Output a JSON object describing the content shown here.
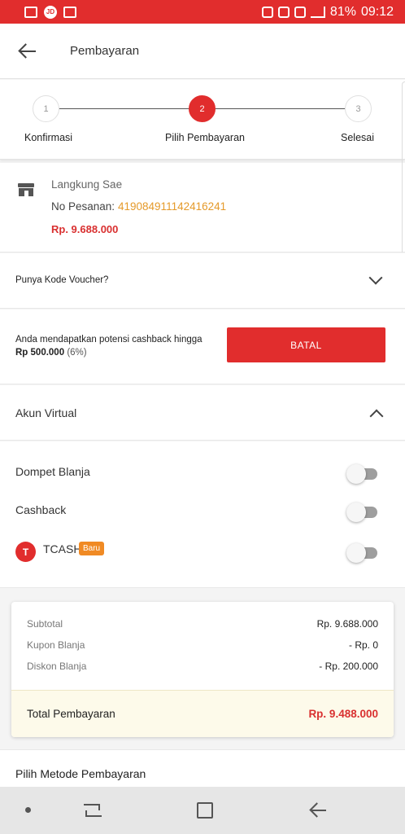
{
  "status_bar": {
    "left_icons": [
      "gallery-icon",
      "jd-icon",
      "message-icon"
    ],
    "right_icons": [
      "alarm-icon",
      "wifi-icon",
      "call-icon",
      "signal-icon"
    ],
    "battery": "81%",
    "time": "09:12",
    "color": "#e12d2d"
  },
  "header": {
    "title": "Pembayaran"
  },
  "stepper": {
    "steps": [
      {
        "num": "1",
        "label": "Konfirmasi",
        "active": false
      },
      {
        "num": "2",
        "label": "Pilih Pembayaran",
        "active": true
      },
      {
        "num": "3",
        "label": "Selesai",
        "active": false
      }
    ]
  },
  "store": {
    "name": "Langkung Sae",
    "order_label": "No Pesanan:",
    "order_number": "419084911142416241",
    "price": "Rp. 9.688.000"
  },
  "voucher": {
    "label": "Punya Kode Voucher?"
  },
  "cashback": {
    "text": "Anda mendapatkan potensi cashback hingga",
    "amount": "Rp 500.000",
    "percent": "(6%)",
    "button": "BATAL"
  },
  "akun_virtual": {
    "title": "Akun Virtual",
    "items": [
      {
        "label": "Dompet Blanja",
        "enabled": false
      },
      {
        "label": "Cashback",
        "enabled": false
      },
      {
        "label": "TCASH",
        "badge": "Baru",
        "enabled": false
      }
    ]
  },
  "summary": {
    "rows": [
      {
        "label": "Subtotal",
        "value": "Rp. 9.688.000"
      },
      {
        "label": "Kupon Blanja",
        "value": "- Rp. 0"
      },
      {
        "label": "Diskon Blanja",
        "value": "- Rp. 200.000"
      }
    ],
    "total_label": "Total Pembayaran",
    "total_value": "Rp. 9.488.000"
  },
  "metode": {
    "title": "Pilih Metode Pembayaran"
  },
  "colors": {
    "accent": "#e12d2d",
    "order_number": "#e59a2a",
    "badge": "#f08a24",
    "total_bg": "#fdfaea"
  }
}
